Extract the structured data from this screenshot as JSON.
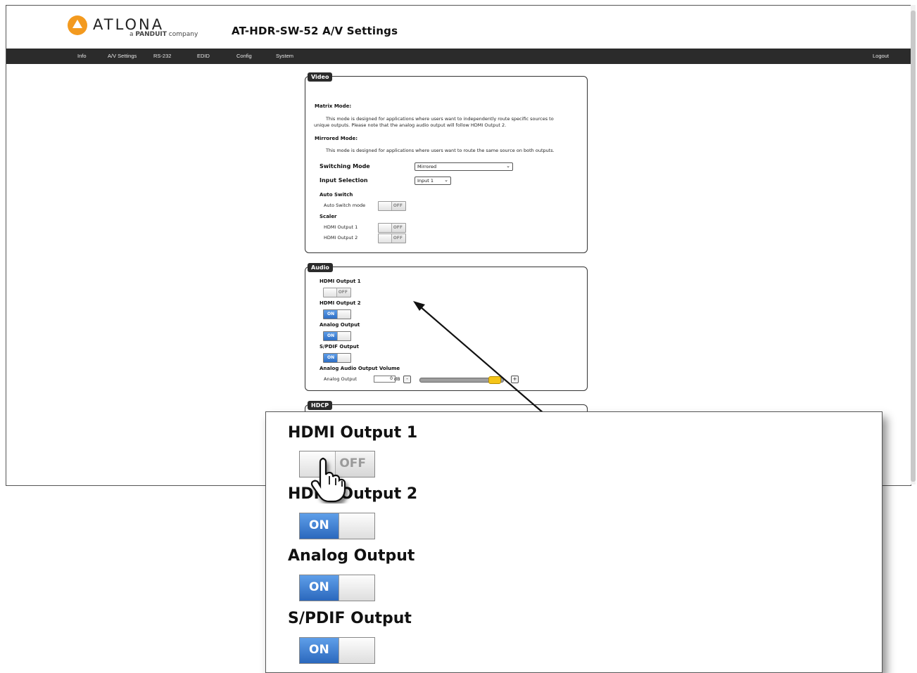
{
  "header": {
    "brand": "ATLONA",
    "brand_sub_prefix": "a ",
    "brand_sub_bold": "PANDUIT",
    "brand_sub_suffix": " company",
    "page_title": "AT-HDR-SW-52  A/V Settings"
  },
  "nav": {
    "items": [
      "Info",
      "A/V Settings",
      "RS-232",
      "EDID",
      "Config",
      "System"
    ],
    "logout": "Logout"
  },
  "video": {
    "tag": "Video",
    "matrix_title": "Matrix Mode:",
    "matrix_line1": "This mode is designed for applications where users want to independently route specific sources to",
    "matrix_line2": "unique outputs. Please note that the analog audio output will follow HDMI Output 2.",
    "mirrored_title": "Mirrored Mode:",
    "mirrored_line1": "This mode is designed for applications where users want to route the same source on both outputs.",
    "switching_mode_label": "Switching Mode",
    "switching_mode_value": "Mirrored",
    "input_selection_label": "Input Selection",
    "input_selection_value": "Input 1",
    "auto_switch_heading": "Auto Switch",
    "auto_switch_mode_label": "Auto Switch mode",
    "auto_switch_state": "OFF",
    "scaler_heading": "Scaler",
    "scaler_out1_label": "HDMI Output 1",
    "scaler_out1_state": "OFF",
    "scaler_out2_label": "HDMI Output 2",
    "scaler_out2_state": "OFF"
  },
  "audio": {
    "tag": "Audio",
    "hdmi_out1_label": "HDMI Output 1",
    "hdmi_out1_state": "OFF",
    "hdmi_out2_label": "HDMI Output 2",
    "hdmi_out2_state": "ON",
    "analog_label": "Analog Output",
    "analog_state": "ON",
    "spdif_label": "S/PDIF Output",
    "spdif_state": "ON",
    "volume_heading": "Analog Audio Output Volume",
    "volume_row_label": "Analog Output",
    "volume_value": "0",
    "volume_unit": "dB",
    "minus": "-",
    "plus": "+",
    "volume_level": 0.9
  },
  "hdcp": {
    "tag": "HDCP"
  },
  "zoom": {
    "hdmi_out1_label": "HDMI Output 1",
    "hdmi_out1_state": "OFF",
    "hdmi_out2_label": "HDMI Output 2",
    "hdmi_out2_state": "ON",
    "analog_label": "Analog Output",
    "analog_state": "ON",
    "spdif_label": "S/PDIF Output",
    "spdif_state": "ON"
  },
  "icons": [
    "logo-icon",
    "chevron-down-icon",
    "hand-pointer-icon",
    "callout-arrow-icon"
  ]
}
